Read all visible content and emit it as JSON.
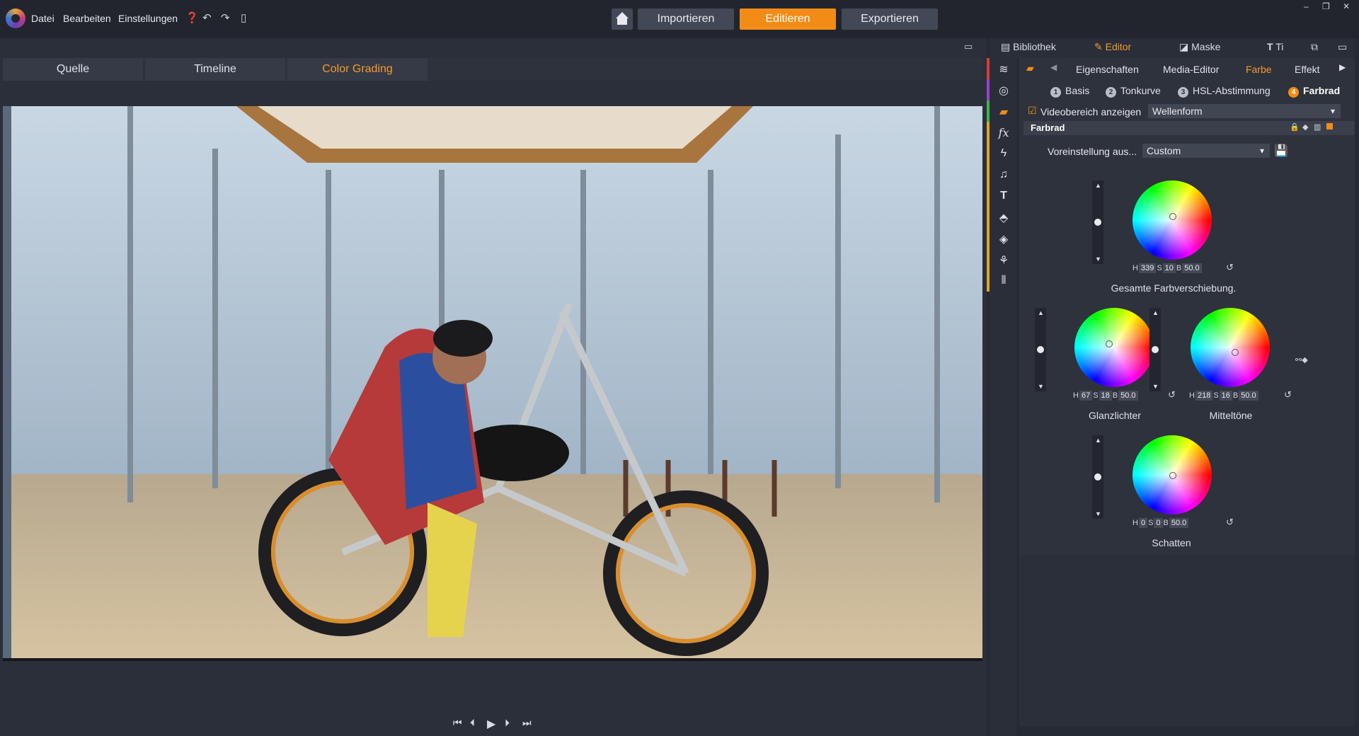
{
  "menu": {
    "datei": "Datei",
    "bearbeiten": "Bearbeiten",
    "einstellungen": "Einstellungen"
  },
  "nav": {
    "import": "Importieren",
    "edit": "Editieren",
    "export": "Exportieren"
  },
  "preview_tabs": [
    "Quelle",
    "Timeline",
    "Color Grading"
  ],
  "right_tabs": {
    "library": "Bibliothek",
    "editor": "Editor",
    "mask": "Maske",
    "title": "Ti"
  },
  "editor_tabs": [
    "Eigenschaften",
    "Media-Editor",
    "Farbe",
    "Effekt"
  ],
  "color_subtabs": [
    {
      "num": "1",
      "label": "Basis"
    },
    {
      "num": "2",
      "label": "Tonkurve"
    },
    {
      "num": "3",
      "label": "HSL-Abstimmung"
    },
    {
      "num": "4",
      "label": "Farbrad"
    }
  ],
  "scope": {
    "checkbox_label": "Videobereich anzeigen",
    "value": "Wellenform"
  },
  "section": {
    "title": "Farbrad"
  },
  "preset": {
    "label": "Voreinstellung aus...",
    "value": "Custom"
  },
  "wheels": {
    "overall": {
      "label": "Gesamte Farbverschiebung.",
      "h": "339",
      "s": "10",
      "b": "50.0"
    },
    "highlights": {
      "label": "Glanzlichter",
      "h": "67",
      "s": "18",
      "b": "50.0"
    },
    "midtones": {
      "label": "Mitteltöne",
      "h": "218",
      "s": "16",
      "b": "50.0"
    },
    "shadows": {
      "label": "Schatten",
      "h": "0",
      "s": "0",
      "b": "50.0"
    }
  },
  "hsb_letters": {
    "h": "H",
    "s": "S",
    "b": "B"
  },
  "colors": {
    "accent": "#f28c16",
    "panel": "#2e323c"
  }
}
